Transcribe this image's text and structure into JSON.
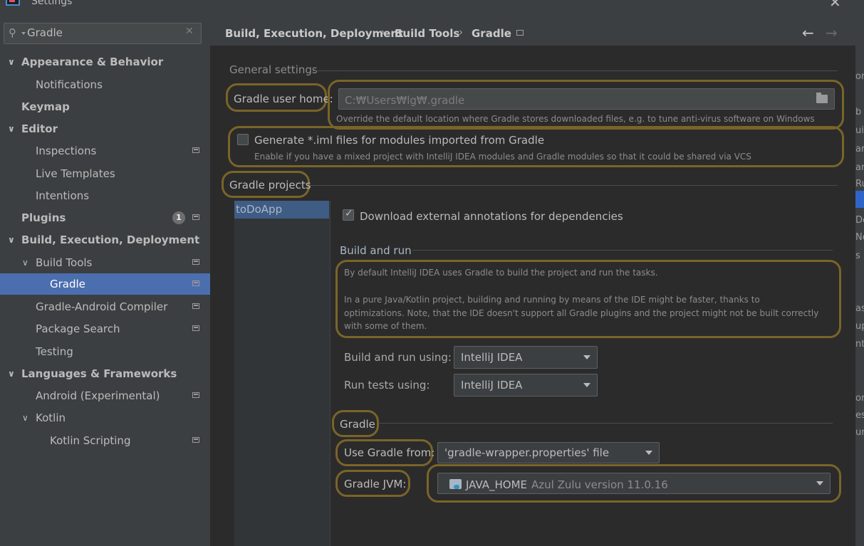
{
  "window": {
    "title": "Settings",
    "close_icon": "close-icon"
  },
  "search": {
    "value": "Gradle",
    "icon": "search-icon",
    "clear_icon": "close-icon"
  },
  "sidebar": {
    "items": [
      {
        "label": "Appearance & Behavior",
        "bold": true,
        "expanded": true
      },
      {
        "label": "Notifications"
      },
      {
        "label": "Keymap",
        "bold": true
      },
      {
        "label": "Editor",
        "bold": true,
        "expanded": true
      },
      {
        "label": "Inspections"
      },
      {
        "label": "Live Templates"
      },
      {
        "label": "Intentions"
      },
      {
        "label": "Plugins",
        "bold": true,
        "badge": "1"
      },
      {
        "label": "Build, Execution, Deployment",
        "bold": true,
        "expanded": true
      },
      {
        "label": "Build Tools",
        "expanded": true
      },
      {
        "label": "Gradle",
        "selected": true
      },
      {
        "label": "Gradle-Android Compiler"
      },
      {
        "label": "Package Search"
      },
      {
        "label": "Testing"
      },
      {
        "label": "Languages & Frameworks",
        "bold": true,
        "expanded": true
      },
      {
        "label": "Android (Experimental)"
      },
      {
        "label": "Kotlin",
        "expanded": true
      },
      {
        "label": "Kotlin Scripting"
      }
    ]
  },
  "breadcrumb": {
    "items": [
      "Build, Execution, Deployment",
      "Build Tools",
      "Gradle"
    ],
    "separator": "›",
    "back": "←",
    "forward": "→"
  },
  "general": {
    "title": "General settings",
    "user_home_label": "Gradle user home:",
    "user_home_value": "C:₩Users₩lg₩.gradle",
    "user_home_hint": "Override the default location where Gradle stores downloaded files, e.g. to tune anti-virus software on Windows",
    "iml_label": "Generate *.iml files for modules imported from Gradle",
    "iml_checked": false,
    "iml_hint": "Enable if you have a mixed project with IntelliJ IDEA modules and Gradle modules so that it could be shared via VCS"
  },
  "projects": {
    "title": "Gradle projects",
    "items": [
      "toDoApp"
    ],
    "download_annotations_label": "Download external annotations for dependencies",
    "download_annotations_checked": true
  },
  "build_run": {
    "title": "Build and run",
    "info_line1": "By default IntelliJ IDEA uses Gradle to build the project and run the tasks.",
    "info_line2": "In a pure Java/Kotlin project, building and running by means of the IDE might be faster, thanks to",
    "info_line3": "optimizations. Note, that the IDE doesn't support all Gradle plugins and the project might not be built correctly",
    "info_line4": "with some of them.",
    "build_using_label": "Build and run using:",
    "build_using_value": "IntelliJ IDEA",
    "tests_using_label": "Run tests using:",
    "tests_using_value": "IntelliJ IDEA"
  },
  "gradle": {
    "title": "Gradle",
    "use_from_label": "Use Gradle from:",
    "use_from_value": "'gradle-wrapper.properties' file",
    "jvm_label": "Gradle JVM:",
    "jvm_value": "JAVA_HOME",
    "jvm_detail": "Azul Zulu version 11.0.16"
  },
  "right_strip": [
    "or",
    "b",
    "ui",
    "ar",
    "ar",
    "Ru",
    "De",
    "Ne",
    "s",
    "as",
    "up",
    "nt",
    "or",
    "es",
    "ura"
  ],
  "colors": {
    "accent": "#4b6eaf",
    "highlight_outline": "#7a6428",
    "background": "#2b2b2b",
    "panel": "#3c3f41"
  }
}
